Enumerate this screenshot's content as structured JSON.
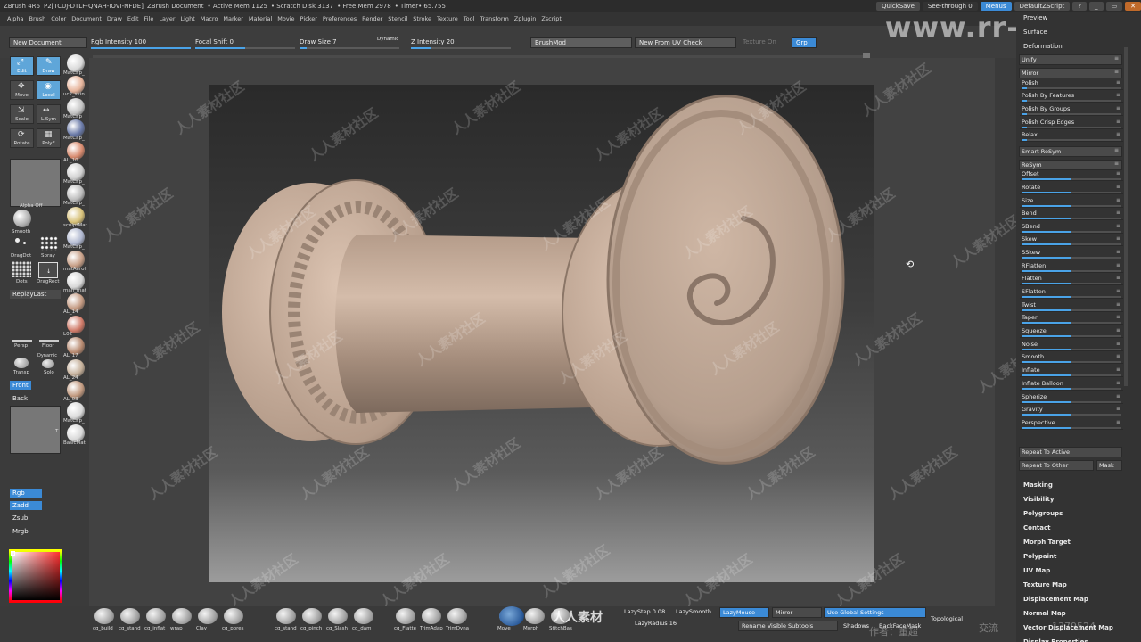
{
  "titlebar": {
    "app": "ZBrush 4R6",
    "doc_code": "P2[TCUJ-DTLF-QNAH-IOVI-NFDE]",
    "doc": "ZBrush Document",
    "active_mem": "• Active Mem 1125",
    "scratch": "• Scratch Disk 3137",
    "free_mem": "• Free Mem 2978",
    "timer": "• Timer• 65.755",
    "quicksave": "QuickSave",
    "see_through": "See-through",
    "see_through_val": "0",
    "menus": "Menus",
    "default_script": "DefaultZScript"
  },
  "menubar": [
    "Alpha",
    "Brush",
    "Color",
    "Document",
    "Draw",
    "Edit",
    "File",
    "Layer",
    "Light",
    "Macro",
    "Marker",
    "Material",
    "Movie",
    "Picker",
    "Preferences",
    "Render",
    "Stencil",
    "Stroke",
    "Texture",
    "Tool",
    "Transform",
    "Zplugin",
    "Zscript"
  ],
  "toptools": {
    "new_document": "New Document",
    "rgb_intensity": "Rgb Intensity 100",
    "focal_shift": "Focal Shift 0",
    "draw_size": "Draw Size 7",
    "dynamic": "Dynamic",
    "z_intensity": "Z Intensity 20",
    "brushmod": "BrushMod",
    "new_from_uv": "New From UV Check",
    "texture_on": "Texture On",
    "grp": "Grp"
  },
  "leftshelf": {
    "edit": "Edit",
    "draw": "Draw",
    "move": "Move",
    "local": "Local",
    "scale": "Scale",
    "lsym": "L.Sym",
    "rotate": "Rotate",
    "polyf": "PolyF",
    "alpha_off": "Alpha  Off",
    "smooth": "Smooth",
    "dragdot": "DragDot",
    "spray": "Spray",
    "dots": "Dots",
    "dragrect": "DragRect",
    "replaylast": "ReplayLast",
    "persp": "Persp",
    "floor": "Floor",
    "transp": "Transp",
    "dynamic": "Dynamic",
    "solo": "Solo",
    "front": "Front",
    "back": "Back",
    "rgb": "Rgb",
    "zadd": "Zadd",
    "zsub": "Zsub",
    "mrgb": "Mrgb",
    "tex_t": "T",
    "materials": [
      "MatCap_",
      "uc2_skin",
      "MatCap_",
      "MatCap_",
      "AL_10",
      "MatCap_",
      "MatCap_",
      "sculptMat",
      "MatCap_",
      "matAeroli",
      "mah_mat",
      "AL_14",
      "L02",
      "AL_17",
      "AL_24",
      "AL_03",
      "MatCap_",
      "BasicMat"
    ]
  },
  "viewport": {
    "watermark_text": "人人素材社区",
    "site_watermark": "www.rr-sc.com"
  },
  "rightpanel": {
    "preview": "Preview",
    "surface": "Surface",
    "deformation": "Deformation",
    "rows": [
      {
        "label": "Unify",
        "boxed": true
      },
      {
        "label": "Mirror",
        "boxed": true
      },
      {
        "label": "Polish",
        "slider": 0.05
      },
      {
        "label": "Polish By Features",
        "slider": 0.05
      },
      {
        "label": "Polish By Groups",
        "slider": 0.05
      },
      {
        "label": "Polish Crisp Edges",
        "slider": 0.05
      },
      {
        "label": "Relax",
        "slider": 0.05
      },
      {
        "label": "Smart ReSym",
        "boxed": true
      },
      {
        "label": "ReSym",
        "boxed": true
      },
      {
        "label": "Offset",
        "slider": 0.5
      },
      {
        "label": "Rotate",
        "slider": 0.5
      },
      {
        "label": "Size",
        "slider": 0.5
      },
      {
        "label": "Bend",
        "slider": 0.5
      },
      {
        "label": "SBend",
        "slider": 0.5
      },
      {
        "label": "Skew",
        "slider": 0.5
      },
      {
        "label": "SSkew",
        "slider": 0.5
      },
      {
        "label": "RFlatten",
        "slider": 0.5
      },
      {
        "label": "Flatten",
        "slider": 0.5
      },
      {
        "label": "SFlatten",
        "slider": 0.5
      },
      {
        "label": "Twist",
        "slider": 0.5
      },
      {
        "label": "Taper",
        "slider": 0.5
      },
      {
        "label": "Squeeze",
        "slider": 0.5
      },
      {
        "label": "Noise",
        "slider": 0.5
      },
      {
        "label": "Smooth",
        "slider": 0.5
      },
      {
        "label": "Inflate",
        "slider": 0.5
      },
      {
        "label": "Inflate Balloon",
        "slider": 0.5
      },
      {
        "label": "Spherize",
        "slider": 0.5
      },
      {
        "label": "Gravity",
        "slider": 0.5
      },
      {
        "label": "Perspective",
        "slider": 0.5
      }
    ],
    "repeat_active": "Repeat To Active",
    "repeat_other": "Repeat To Other",
    "mask": "Mask",
    "subpalettes": [
      "Masking",
      "Visibility",
      "Polygroups",
      "Contact",
      "Morph Target",
      "Polypaint",
      "UV Map",
      "Texture Map",
      "Displacement Map",
      "Normal Map",
      "Vector Displacement Map",
      "Display Properties"
    ]
  },
  "bottomshelf": {
    "brushes": [
      "cg_build",
      "cg_stand",
      "cg_inflat",
      "wrap",
      "Clay",
      "cg_pores",
      "cg_stand",
      "cg_pinch",
      "cg_Slash",
      "cg_dam",
      "cg_Flatte",
      "TrimAdap",
      "TrimDyna",
      "Move",
      "Morph",
      "StitchBas"
    ],
    "lazystep": "LazyStep 0.08",
    "lazysmooth": "LazySmooth",
    "lazymouse": "LazyMouse",
    "mirror": "Mirror",
    "use_global": "Use Global Settings",
    "topological": "Topological",
    "lazyradius": "LazyRadius 16",
    "rename_subtools": "Rename Visible Subtools",
    "shadows": "Shadows",
    "backfacemask": "BackFaceMask",
    "author": "作者：董超",
    "exchange": "交流",
    "number": "1379524",
    "logo_text": "人人素材"
  },
  "colors": {
    "accent": "#3b8ad6",
    "panel": "#333333",
    "model": "#c7ad9b"
  }
}
